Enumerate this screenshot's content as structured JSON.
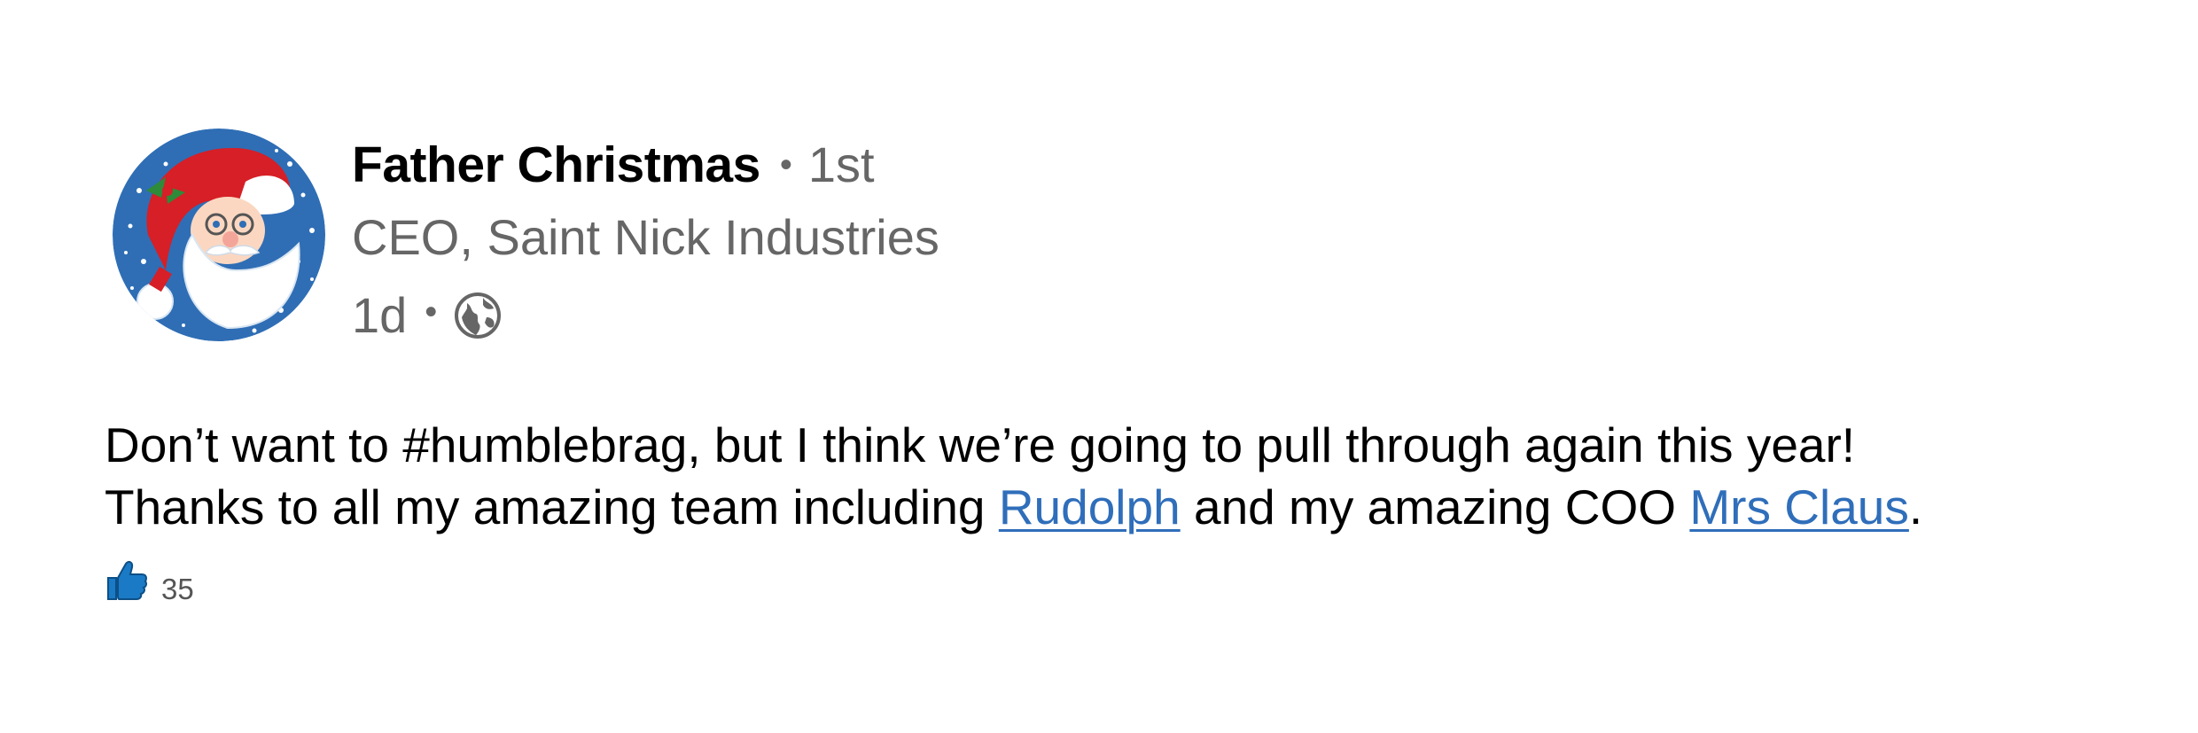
{
  "author": {
    "name": "Father Christmas",
    "connection_separator": "•",
    "connection_degree": "1st",
    "headline": "CEO, Saint Nick Industries",
    "avatar_icon": "santa-avatar-icon"
  },
  "post_meta": {
    "timestamp": "1d",
    "separator": "•",
    "visibility_icon": "globe-icon"
  },
  "body": {
    "line1": "Don’t want to #humblebrag, but I think we’re going to pull through again this year!",
    "line2_prefix": "Thanks to all my amazing team including ",
    "mention1": "Rudolph",
    "line2_middle": " and my amazing COO ",
    "mention2": "Mrs Claus",
    "line2_suffix": "."
  },
  "reactions": {
    "icon": "thumbs-up-icon",
    "count": "35"
  },
  "colors": {
    "link": "#2f6eba",
    "secondary_text": "#666666",
    "avatar_bg": "#2f6eb5",
    "like_icon": "#1a7ac6"
  }
}
